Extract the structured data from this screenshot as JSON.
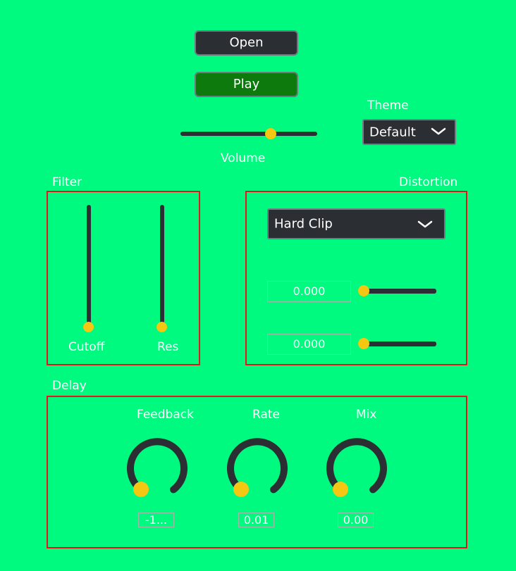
{
  "buttons": {
    "open": "Open",
    "play": "Play"
  },
  "theme": {
    "label": "Theme",
    "selected": "Default"
  },
  "volume": {
    "label": "Volume",
    "value_fraction": 0.67
  },
  "filter": {
    "title": "Filter",
    "cutoff": {
      "label": "Cutoff",
      "value_fraction": 0.0
    },
    "res": {
      "label": "Res",
      "value_fraction": 0.0
    }
  },
  "distortion": {
    "title": "Distortion",
    "mode": "Hard Clip",
    "param1": {
      "value": "0.000",
      "fraction": 0.0
    },
    "param2": {
      "value": "0.000",
      "fraction": 0.0
    }
  },
  "delay": {
    "title": "Delay",
    "feedback": {
      "label": "Feedback",
      "value": "-1..."
    },
    "rate": {
      "label": "Rate",
      "value": "0.01"
    },
    "mix": {
      "label": "Mix",
      "value": "0.00"
    }
  },
  "colors": {
    "background": "#00fa7f",
    "panel_border": "#e8141c",
    "control_dark": "#2b2f33",
    "thumb": "#f3c712",
    "play_green": "#0d7a0d"
  },
  "icons": {
    "dropdown": "chevron-down-icon"
  }
}
